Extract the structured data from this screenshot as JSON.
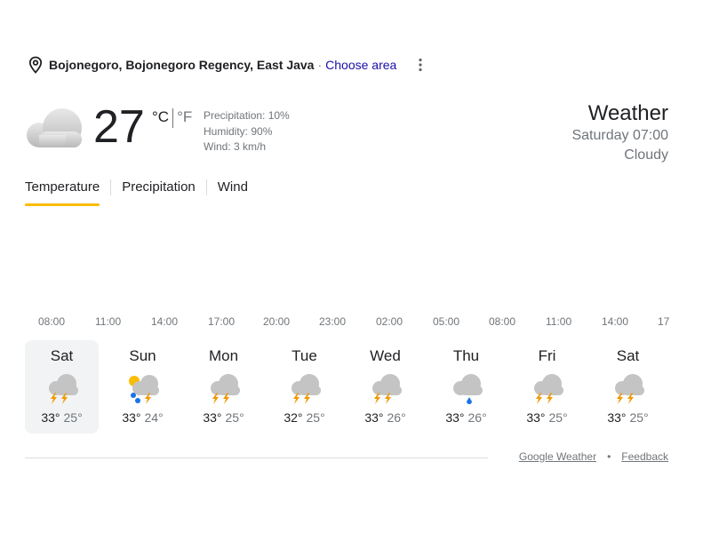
{
  "location": {
    "name": "Bojonegoro, Bojonegoro Regency, East Java",
    "separator": "·",
    "choose_area": "Choose area"
  },
  "current": {
    "icon": "cloud-icon",
    "temperature": "27",
    "unit_c": "°C",
    "unit_f": "°F",
    "precipitation": "Precipitation: 10%",
    "humidity": "Humidity: 90%",
    "wind": "Wind: 3 km/h"
  },
  "header": {
    "title": "Weather",
    "datetime": "Saturday 07:00",
    "condition": "Cloudy"
  },
  "tabs": [
    "Temperature",
    "Precipitation",
    "Wind"
  ],
  "hours": [
    "08:00",
    "11:00",
    "14:00",
    "17:00",
    "20:00",
    "23:00",
    "02:00",
    "05:00",
    "08:00",
    "11:00",
    "14:00",
    "17"
  ],
  "days": [
    {
      "name": "Sat",
      "icon": "thunderstorm-icon",
      "high": "33°",
      "low": "25°"
    },
    {
      "name": "Sun",
      "icon": "sun-thunder-rain-icon",
      "high": "33°",
      "low": "24°"
    },
    {
      "name": "Mon",
      "icon": "thunderstorm-icon",
      "high": "33°",
      "low": "25°"
    },
    {
      "name": "Tue",
      "icon": "thunderstorm-icon",
      "high": "32°",
      "low": "25°"
    },
    {
      "name": "Wed",
      "icon": "thunderstorm-icon",
      "high": "33°",
      "low": "26°"
    },
    {
      "name": "Thu",
      "icon": "rain-cloud-icon",
      "high": "33°",
      "low": "26°"
    },
    {
      "name": "Fri",
      "icon": "thunderstorm-icon",
      "high": "33°",
      "low": "25°"
    },
    {
      "name": "Sat",
      "icon": "thunderstorm-icon",
      "high": "33°",
      "low": "25°"
    }
  ],
  "footer": {
    "source": "Google Weather",
    "dot": "•",
    "feedback": "Feedback"
  },
  "colors": {
    "accent": "#fbbc04",
    "link": "#1a0dab",
    "secondary_text": "#70757a",
    "lightning": "#f29900",
    "rain": "#1a73e8"
  }
}
